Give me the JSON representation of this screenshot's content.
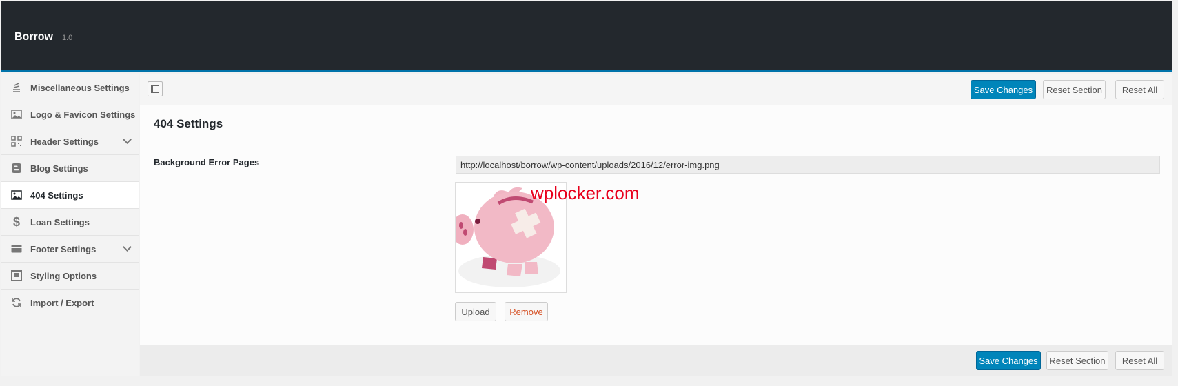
{
  "header": {
    "title": "Borrow",
    "version": "1.0"
  },
  "sidebar": {
    "items": [
      {
        "label": "Miscellaneous Settings",
        "icon": "stack-icon"
      },
      {
        "label": "Logo & Favicon Settings",
        "icon": "image-icon"
      },
      {
        "label": "Header Settings",
        "icon": "qr-code-icon",
        "expandable": true
      },
      {
        "label": "Blog Settings",
        "icon": "blogger-icon"
      },
      {
        "label": "404 Settings",
        "icon": "image-icon",
        "active": true
      },
      {
        "label": "Loan Settings",
        "icon": "dollar-icon"
      },
      {
        "label": "Footer Settings",
        "icon": "credit-card-icon",
        "expandable": true
      },
      {
        "label": "Styling Options",
        "icon": "window-icon"
      },
      {
        "label": "Import / Export",
        "icon": "refresh-icon"
      }
    ]
  },
  "toolbar": {
    "save_label": "Save Changes",
    "reset_section_label": "Reset Section",
    "reset_all_label": "Reset All"
  },
  "main": {
    "section_title": "404 Settings",
    "field_label": "Background Error Pages",
    "field_value": "http://localhost/borrow/wp-content/uploads/2016/12/error-img.png",
    "upload_label": "Upload",
    "remove_label": "Remove"
  },
  "watermark": "wplocker.com",
  "colors": {
    "header_bg": "#23282d",
    "accent": "#0085ba",
    "remove": "#d54e21",
    "watermark": "#e8001c"
  }
}
